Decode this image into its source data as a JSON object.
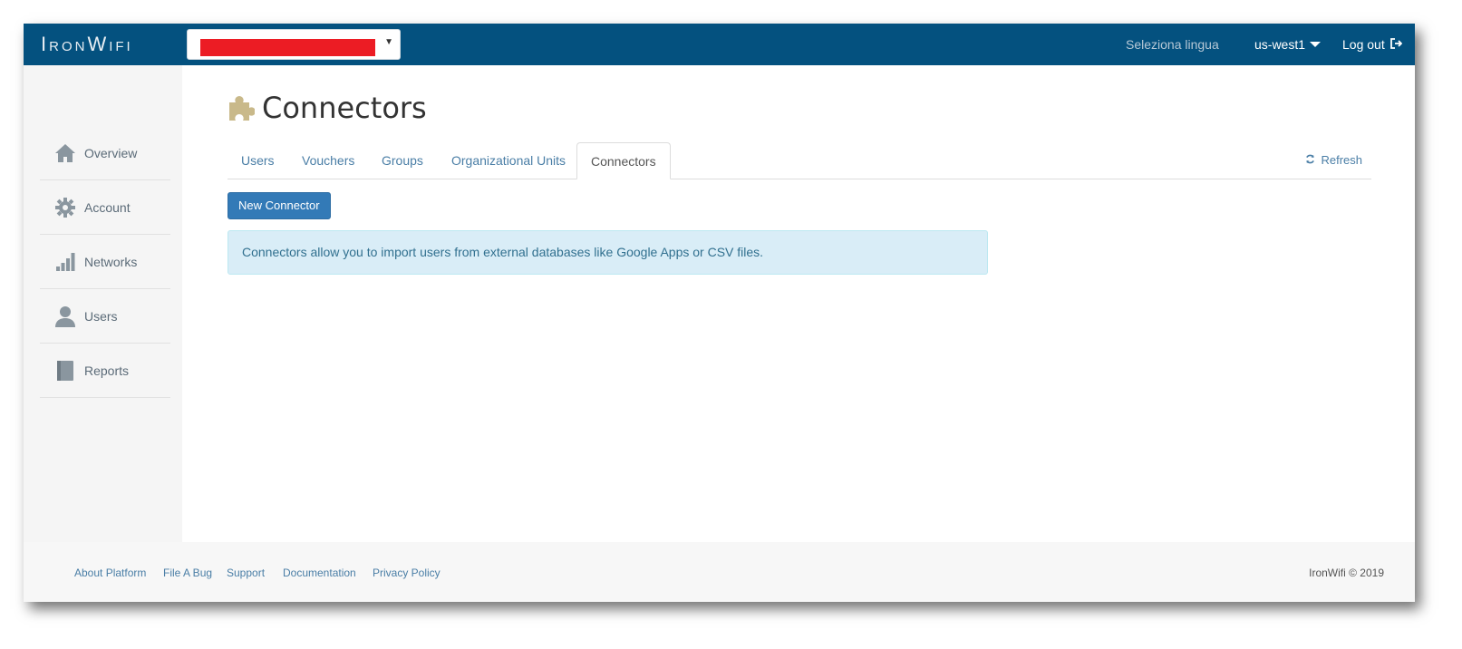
{
  "navbar": {
    "brand": "IronWifi",
    "org_select_caret": "▼",
    "language": "Seleziona lingua",
    "region": "us-west1",
    "logout": "Log out"
  },
  "sidebar": {
    "items": [
      {
        "label": "Overview",
        "icon": "home-icon"
      },
      {
        "label": "Account",
        "icon": "gear-icon"
      },
      {
        "label": "Networks",
        "icon": "signal-bars-icon"
      },
      {
        "label": "Users",
        "icon": "user-icon"
      },
      {
        "label": "Reports",
        "icon": "book-icon"
      }
    ]
  },
  "main": {
    "title": "Connectors",
    "tabs": [
      {
        "label": "Users"
      },
      {
        "label": "Vouchers"
      },
      {
        "label": "Groups"
      },
      {
        "label": "Organizational Units"
      },
      {
        "label": "Connectors",
        "active": true
      }
    ],
    "refresh": "Refresh",
    "new_button": "New Connector",
    "info": "Connectors allow you to import users from external databases like Google Apps or CSV files."
  },
  "footer": {
    "links": [
      {
        "label": "About Platform"
      },
      {
        "label": "File A Bug"
      },
      {
        "label": "Support"
      },
      {
        "label": "Documentation"
      },
      {
        "label": "Privacy Policy"
      }
    ],
    "copyright": "IronWifi © 2019"
  },
  "colors": {
    "navbar": "#04517f",
    "primary_button": "#337ab7",
    "info_bg": "#d9edf7",
    "redaction": "#ec1c24",
    "title_icon": "#c9b98a"
  }
}
